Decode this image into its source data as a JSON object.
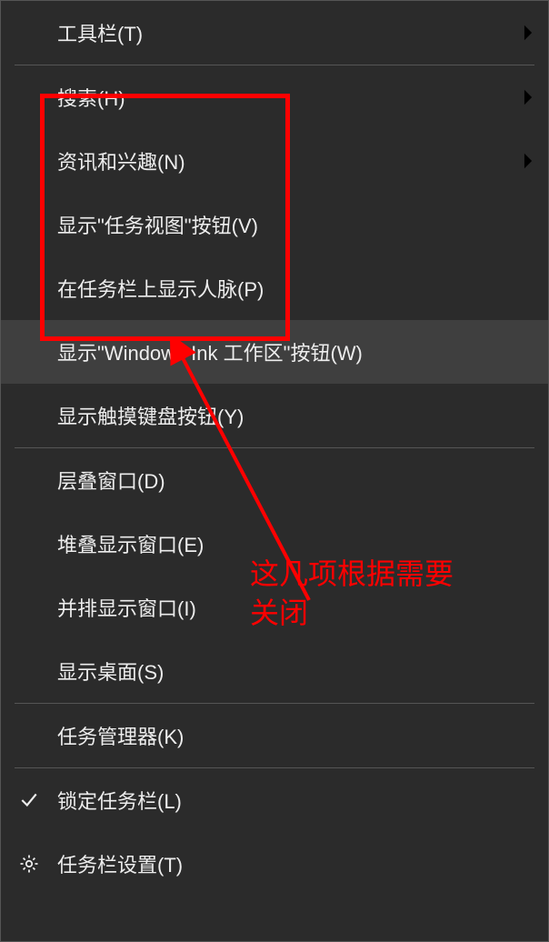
{
  "menu": {
    "toolbars": {
      "label": "工具栏(T)",
      "has_submenu": true
    },
    "search": {
      "label": "搜索(H)",
      "has_submenu": true
    },
    "news": {
      "label": "资讯和兴趣(N)",
      "has_submenu": true
    },
    "taskview": {
      "label": "显示\"任务视图\"按钮(V)"
    },
    "people": {
      "label": "在任务栏上显示人脉(P)"
    },
    "ink": {
      "label": "显示\"Windows Ink 工作区\"按钮(W)"
    },
    "touchkb": {
      "label": "显示触摸键盘按钮(Y)"
    },
    "cascade": {
      "label": "层叠窗口(D)"
    },
    "stacked": {
      "label": "堆叠显示窗口(E)"
    },
    "sidebyside": {
      "label": "并排显示窗口(I)"
    },
    "desktop": {
      "label": "显示桌面(S)"
    },
    "taskmgr": {
      "label": "任务管理器(K)"
    },
    "lock": {
      "label": "锁定任务栏(L)",
      "checked": true
    },
    "settings": {
      "label": "任务栏设置(T)",
      "icon": "gear"
    }
  },
  "annotation": {
    "text": "这几项根据需要\n关闭",
    "color": "#ff0000"
  }
}
